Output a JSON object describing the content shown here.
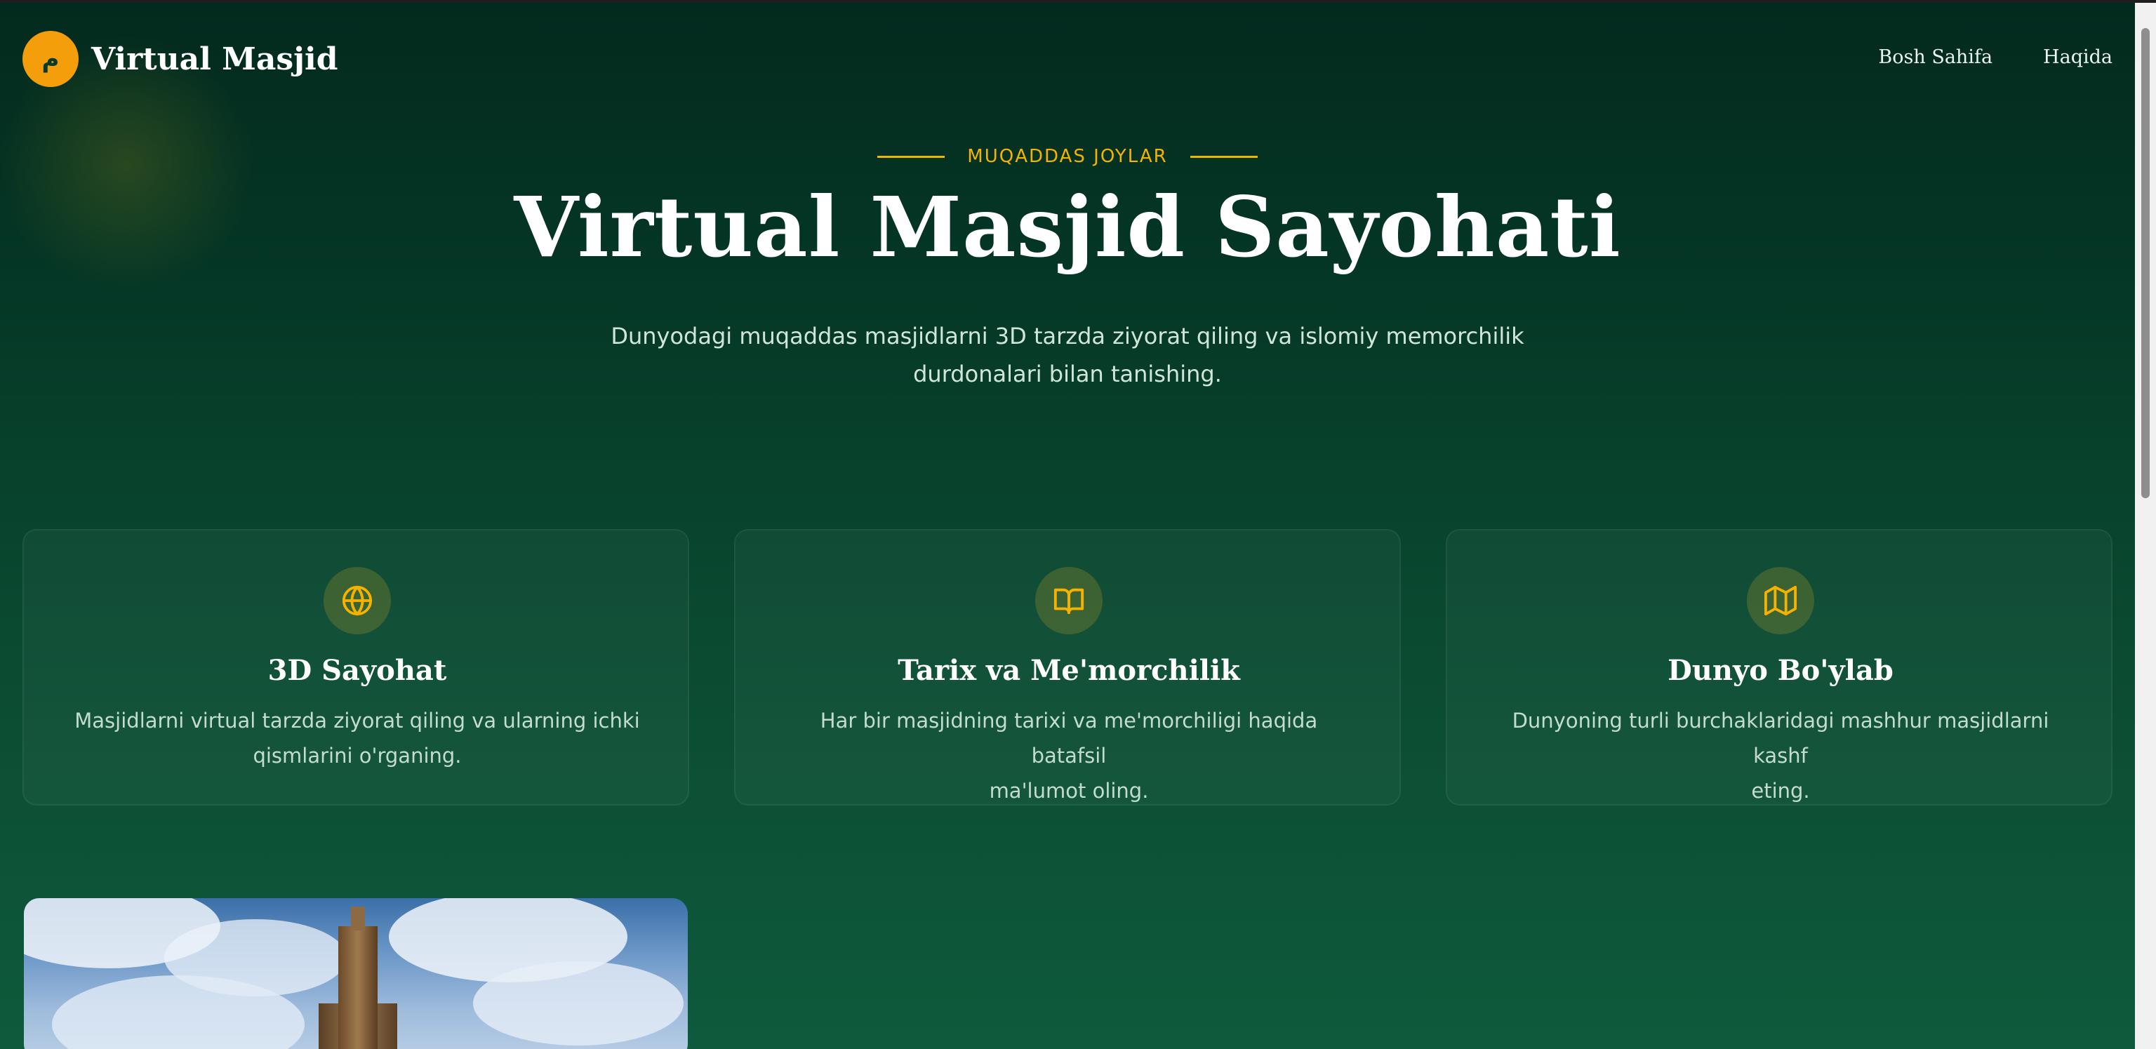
{
  "brand": {
    "badge": "م",
    "name": "Virtual Masjid"
  },
  "nav": {
    "links": [
      "Bosh Sahifa",
      "Haqida"
    ]
  },
  "hero": {
    "eyebrow": "MUQADDAS JOYLAR",
    "title": "Virtual Masjid Sayohati",
    "subtitle_line1": "Dunyodagi muqaddas masjidlarni 3D tarzda ziyorat qiling va islomiy memorchilik",
    "subtitle_line2": "durdonalari bilan tanishing."
  },
  "features": [
    {
      "icon": "globe-icon",
      "title": "3D Sayohat",
      "text_line1": "Masjidlarni virtual tarzda ziyorat qiling va ularning ichki",
      "text_line2": "qismlarini o'rganing."
    },
    {
      "icon": "book-open-icon",
      "title": "Tarix va Me'morchilik",
      "text_line1": "Har bir masjidning tarixi va me'morchiligi haqida batafsil",
      "text_line2": "ma'lumot oling."
    },
    {
      "icon": "map-icon",
      "title": "Dunyo Bo'ylab",
      "text_line1": "Dunyoning turli burchaklaridagi mashhur masjidlarni kashf",
      "text_line2": "eting."
    }
  ],
  "colors": {
    "accent": "#f59e0b",
    "gold": "#f5b301",
    "background": "#053826"
  }
}
